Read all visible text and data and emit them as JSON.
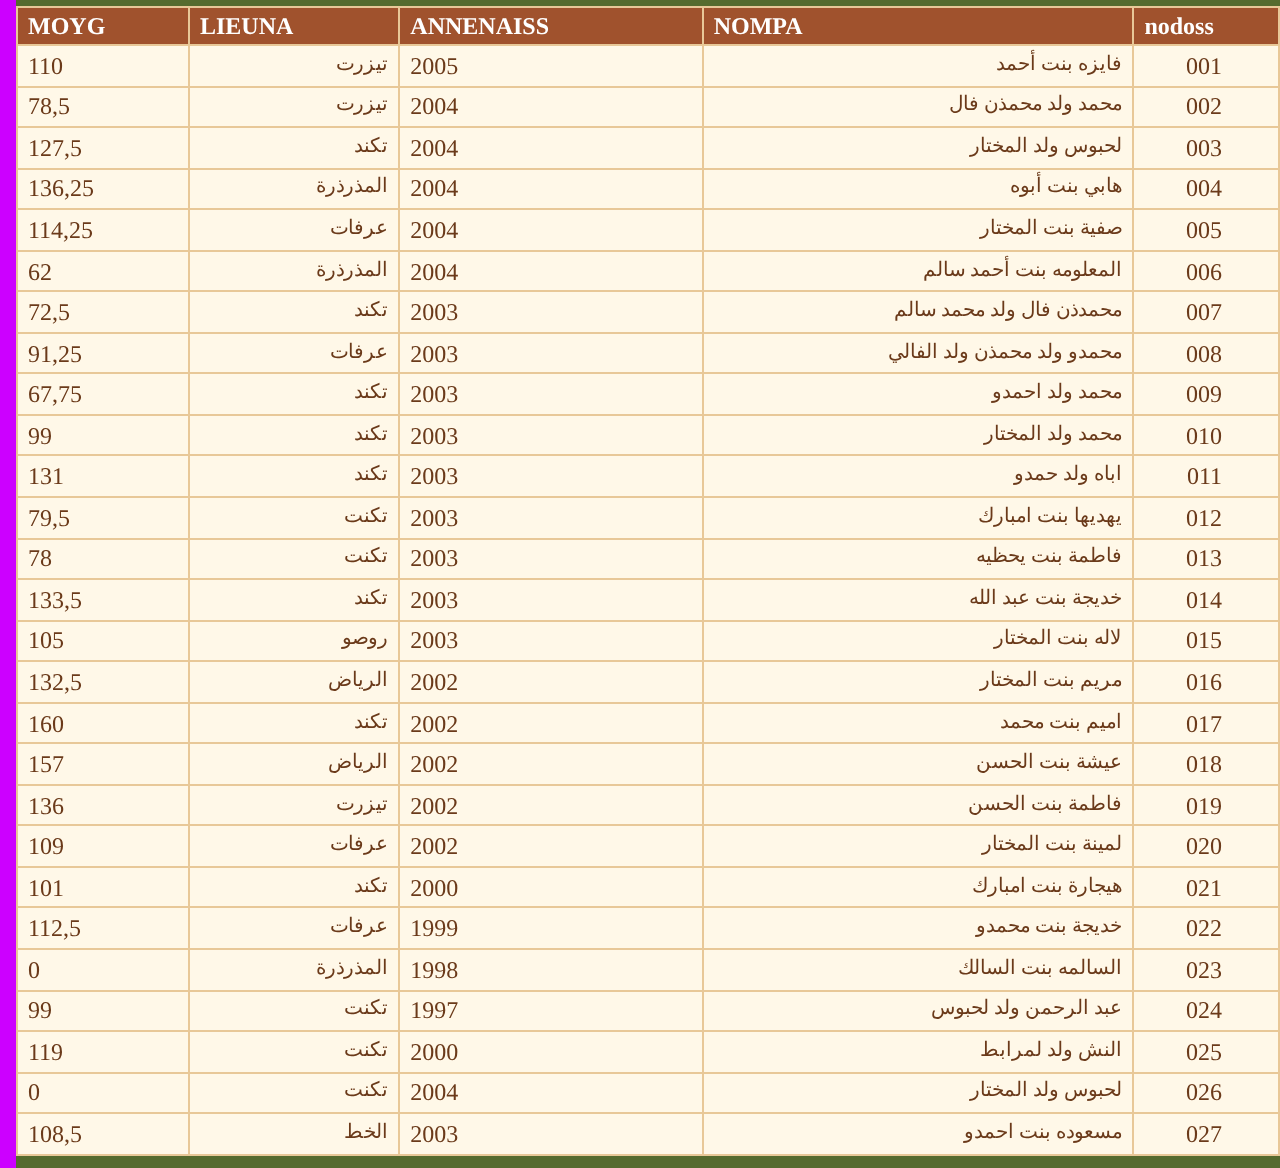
{
  "table": {
    "columns": [
      "nodoss",
      "NOMPA",
      "ANNENAISS",
      "LIEUNA",
      "MOYG"
    ],
    "rows": [
      [
        "001",
        "فايزه بنت أحمد",
        "2005",
        "تيزرت",
        "110"
      ],
      [
        "002",
        "محمد ولد محمذن فال",
        "2004",
        "تيزرت",
        "78,5"
      ],
      [
        "003",
        "لحبوس ولد المختار",
        "2004",
        "تكند",
        "127,5"
      ],
      [
        "004",
        "هابي بنت أبوه",
        "2004",
        "المذرذرة",
        "136,25"
      ],
      [
        "005",
        "صفية بنت المختار",
        "2004",
        "عرفات",
        "114,25"
      ],
      [
        "006",
        "المعلومه بنت أحمد سالم",
        "2004",
        "المذرذرة",
        "62"
      ],
      [
        "007",
        "محمدذن فال ولد محمد سالم",
        "2003",
        "تكند",
        "72,5"
      ],
      [
        "008",
        "محمدو ولد محمذن ولد الفالي",
        "2003",
        "عرفات",
        "91,25"
      ],
      [
        "009",
        "محمد ولد احمدو",
        "2003",
        "تكند",
        "67,75"
      ],
      [
        "010",
        "محمد ولد المختار",
        "2003",
        "تكند",
        "99"
      ],
      [
        "011",
        "اباه ولد حمدو",
        "2003",
        "تكند",
        "131"
      ],
      [
        "012",
        "يهديها بنت امبارك",
        "2003",
        "تكنت",
        "79,5"
      ],
      [
        "013",
        "فاطمة بنت يحظيه",
        "2003",
        "تكنت",
        "78"
      ],
      [
        "014",
        "خديجة بنت عبد الله",
        "2003",
        "تكند",
        "133,5"
      ],
      [
        "015",
        "لاله بنت المختار",
        "2003",
        "روصو",
        "105"
      ],
      [
        "016",
        "مريم بنت المختار",
        "2002",
        "الرياض",
        "132,5"
      ],
      [
        "017",
        "اميم بنت محمد",
        "2002",
        "تكند",
        "160"
      ],
      [
        "018",
        "عيشة بنت الحسن",
        "2002",
        "الرياض",
        "157"
      ],
      [
        "019",
        "فاطمة بنت الحسن",
        "2002",
        "تيزرت",
        "136"
      ],
      [
        "020",
        "لمينة بنت المختار",
        "2002",
        "عرفات",
        "109"
      ],
      [
        "021",
        "هيجارة بنت امبارك",
        "2000",
        "تكند",
        "101"
      ],
      [
        "022",
        "خديجة بنت محمدو",
        "1999",
        "عرفات",
        "112,5"
      ],
      [
        "023",
        "السالمه بنت السالك",
        "1998",
        "المذرذرة",
        "0"
      ],
      [
        "024",
        "عبد الرحمن ولد لحبوس",
        "1997",
        "تكنت",
        "99"
      ],
      [
        "025",
        "النش ولد لمرابط",
        "2000",
        "تكنت",
        "119"
      ],
      [
        "026",
        "لحبوس ولد المختار",
        "2004",
        "تكنت",
        "0"
      ],
      [
        "027",
        "مسعوده بنت احمدو",
        "2003",
        "الخط",
        "108,5"
      ]
    ]
  }
}
